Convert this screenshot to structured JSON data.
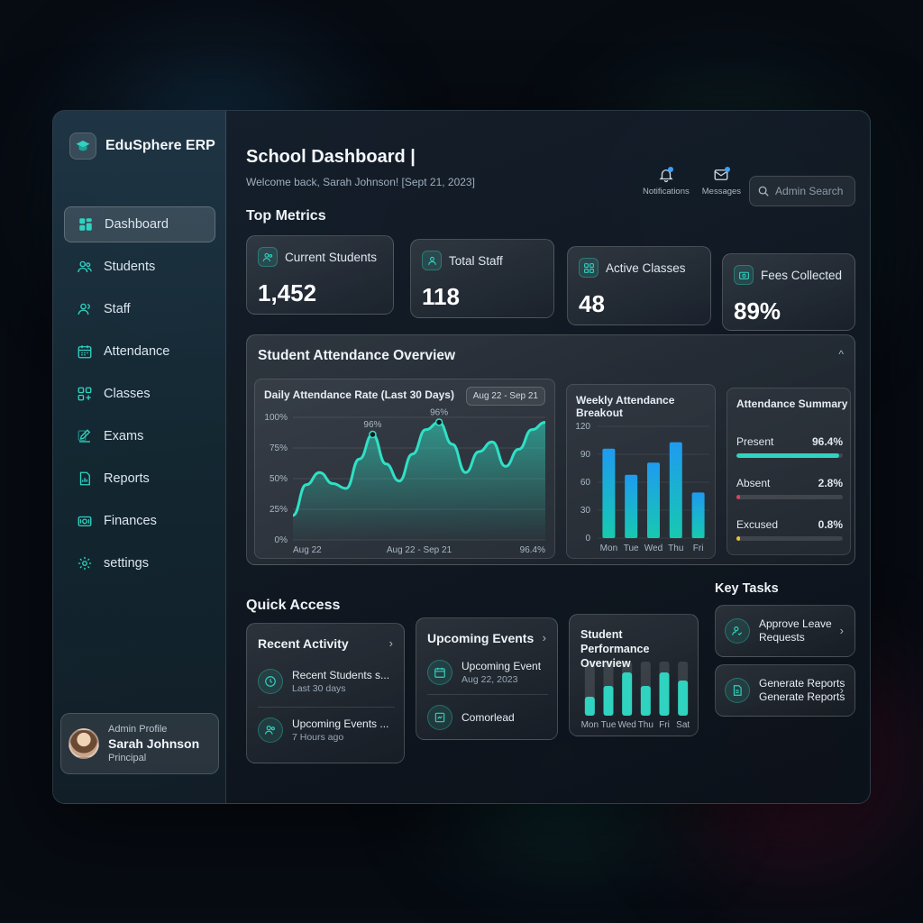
{
  "app": {
    "name": "EduSphere ERP"
  },
  "sidebar": {
    "items": [
      {
        "label": "Dashboard",
        "icon": "grid-icon"
      },
      {
        "label": "Students",
        "icon": "users-icon"
      },
      {
        "label": "Staff",
        "icon": "user-group-icon"
      },
      {
        "label": "Attendance",
        "icon": "calendar-icon"
      },
      {
        "label": "Classes",
        "icon": "classes-icon"
      },
      {
        "label": "Exams",
        "icon": "edit-icon"
      },
      {
        "label": "Reports",
        "icon": "report-icon"
      },
      {
        "label": "Finances",
        "icon": "finance-icon"
      },
      {
        "label": "settings",
        "icon": "gear-icon"
      }
    ],
    "profile": {
      "role_label": "Admin Profile",
      "name": "Sarah Johnson",
      "title": "Principal"
    }
  },
  "header": {
    "title": "School Dashboard |",
    "welcome": "Welcome back, Sarah Johnson! [Sept 21, 2023]",
    "notifications_label": "Notifications",
    "messages_label": "Messages",
    "search_placeholder": "Admin Search"
  },
  "metrics": {
    "section_title": "Top Metrics",
    "cards": [
      {
        "label": "Current Students",
        "value": "1,452"
      },
      {
        "label": "Total Staff",
        "value": "118"
      },
      {
        "label": "Active Classes",
        "value": "48"
      },
      {
        "label": "Fees Collected",
        "value": "89%"
      }
    ]
  },
  "overview": {
    "title": "Student Attendance Overview",
    "collapse_glyph": "^"
  },
  "chart_data": [
    {
      "type": "area",
      "title": "Daily Attendance Rate (Last 30 Days)",
      "date_range": "Aug 22 - Sep 21",
      "y_ticks": [
        "100%",
        "75%",
        "50%",
        "25%",
        "0%"
      ],
      "ylim": [
        0,
        100
      ],
      "x_labels": [
        "Aug 22",
        "Aug 22 - Sep 21",
        "96.4%"
      ],
      "values": [
        20,
        45,
        55,
        46,
        42,
        66,
        86,
        62,
        48,
        70,
        90,
        96,
        78,
        55,
        72,
        80,
        60,
        74,
        90,
        96
      ],
      "annotations": [
        {
          "index": 6,
          "label": "96%"
        },
        {
          "index": 11,
          "label": "96%"
        }
      ],
      "color": "#2fe0c5"
    },
    {
      "type": "bar",
      "title": "Weekly Attendance Breakout",
      "categories": [
        "Mon",
        "Tue",
        "Wed",
        "Thu",
        "Fri"
      ],
      "values": [
        96,
        68,
        81,
        103,
        49
      ],
      "y_ticks": [
        "120",
        "90",
        "60",
        "30",
        "0"
      ],
      "ylim": [
        0,
        120
      ],
      "color": "#1e9bf0"
    },
    {
      "type": "bar",
      "title": "Student Performance Overview",
      "categories": [
        "Mon",
        "Tue",
        "Wed",
        "Thu",
        "Fri",
        "Sat"
      ],
      "values": [
        0.35,
        0.55,
        0.8,
        0.55,
        0.8,
        0.65
      ],
      "color": "#2fd3c0"
    }
  ],
  "summary": {
    "title": "Attendance Summary",
    "rows": [
      {
        "label": "Present",
        "value": "96.4%",
        "fraction": 0.964,
        "color": "#2fd3c0"
      },
      {
        "label": "Absent",
        "value": "2.8%",
        "fraction": 0.028,
        "color": "#e0405f"
      },
      {
        "label": "Excused",
        "value": "0.8%",
        "fraction": 0.008,
        "color": "#e8c040"
      }
    ]
  },
  "quick_access": {
    "section_title": "Quick Access",
    "recent": {
      "title": "Recent Activity",
      "items": [
        {
          "main": "Recent Students s...",
          "sub": "Last 30 days"
        },
        {
          "main": "Upcoming Events ...",
          "sub": "7 Hours ago"
        }
      ]
    },
    "events": {
      "title": "Upcoming Events",
      "items": [
        {
          "main": "Upcoming Event",
          "sub": "Aug 22, 2023"
        },
        {
          "main": "Comorlead",
          "sub": ""
        }
      ]
    }
  },
  "key_tasks": {
    "section_title": "Key Tasks",
    "items": [
      {
        "line1": "Approve Leave",
        "line2": "Requests"
      },
      {
        "line1": "Generate Reports",
        "line2": "Generate Reports"
      }
    ]
  },
  "glyphs": {
    "chevron": "›"
  }
}
